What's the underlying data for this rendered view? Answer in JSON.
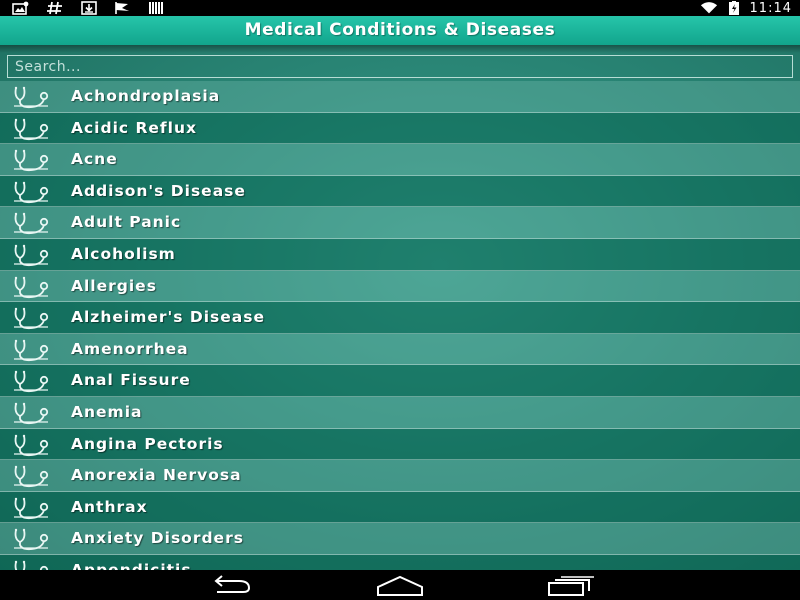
{
  "status_bar": {
    "time": "11:14",
    "left_icons": [
      "gallery-notification-icon",
      "hash-notification-icon",
      "download-notification-icon",
      "flag-notification-icon",
      "barcode-notification-icon"
    ],
    "right_icons": [
      "wifi-icon",
      "battery-charging-icon"
    ]
  },
  "header": {
    "title": "Medical Conditions & Diseases"
  },
  "search": {
    "placeholder": "Search...",
    "value": ""
  },
  "list": {
    "item_icon": "stethoscope-icon",
    "items": [
      {
        "label": "Achondroplasia"
      },
      {
        "label": "Acidic Reflux"
      },
      {
        "label": "Acne"
      },
      {
        "label": "Addison's Disease"
      },
      {
        "label": "Adult Panic"
      },
      {
        "label": "Alcoholism"
      },
      {
        "label": "Allergies"
      },
      {
        "label": "Alzheimer's Disease"
      },
      {
        "label": "Amenorrhea"
      },
      {
        "label": "Anal Fissure"
      },
      {
        "label": "Anemia"
      },
      {
        "label": "Angina Pectoris"
      },
      {
        "label": "Anorexia Nervosa"
      },
      {
        "label": "Anthrax"
      },
      {
        "label": "Anxiety Disorders"
      },
      {
        "label": "Appendicitis"
      }
    ]
  },
  "nav_bar": {
    "buttons": [
      "back-icon",
      "home-icon",
      "recent-apps-icon"
    ]
  },
  "colors": {
    "title_bar": "#1ab79c",
    "background": "#2a8676",
    "text": "#ffffff"
  }
}
